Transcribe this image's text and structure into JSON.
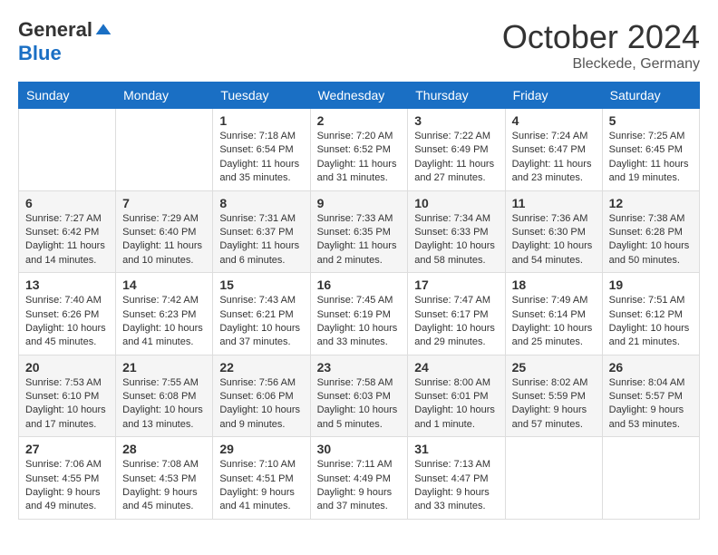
{
  "logo": {
    "general": "General",
    "blue": "Blue"
  },
  "title": "October 2024",
  "subtitle": "Bleckede, Germany",
  "days_of_week": [
    "Sunday",
    "Monday",
    "Tuesday",
    "Wednesday",
    "Thursday",
    "Friday",
    "Saturday"
  ],
  "weeks": [
    [
      {
        "day": "",
        "sunrise": "",
        "sunset": "",
        "daylight": ""
      },
      {
        "day": "",
        "sunrise": "",
        "sunset": "",
        "daylight": ""
      },
      {
        "day": "1",
        "sunrise": "Sunrise: 7:18 AM",
        "sunset": "Sunset: 6:54 PM",
        "daylight": "Daylight: 11 hours and 35 minutes."
      },
      {
        "day": "2",
        "sunrise": "Sunrise: 7:20 AM",
        "sunset": "Sunset: 6:52 PM",
        "daylight": "Daylight: 11 hours and 31 minutes."
      },
      {
        "day": "3",
        "sunrise": "Sunrise: 7:22 AM",
        "sunset": "Sunset: 6:49 PM",
        "daylight": "Daylight: 11 hours and 27 minutes."
      },
      {
        "day": "4",
        "sunrise": "Sunrise: 7:24 AM",
        "sunset": "Sunset: 6:47 PM",
        "daylight": "Daylight: 11 hours and 23 minutes."
      },
      {
        "day": "5",
        "sunrise": "Sunrise: 7:25 AM",
        "sunset": "Sunset: 6:45 PM",
        "daylight": "Daylight: 11 hours and 19 minutes."
      }
    ],
    [
      {
        "day": "6",
        "sunrise": "Sunrise: 7:27 AM",
        "sunset": "Sunset: 6:42 PM",
        "daylight": "Daylight: 11 hours and 14 minutes."
      },
      {
        "day": "7",
        "sunrise": "Sunrise: 7:29 AM",
        "sunset": "Sunset: 6:40 PM",
        "daylight": "Daylight: 11 hours and 10 minutes."
      },
      {
        "day": "8",
        "sunrise": "Sunrise: 7:31 AM",
        "sunset": "Sunset: 6:37 PM",
        "daylight": "Daylight: 11 hours and 6 minutes."
      },
      {
        "day": "9",
        "sunrise": "Sunrise: 7:33 AM",
        "sunset": "Sunset: 6:35 PM",
        "daylight": "Daylight: 11 hours and 2 minutes."
      },
      {
        "day": "10",
        "sunrise": "Sunrise: 7:34 AM",
        "sunset": "Sunset: 6:33 PM",
        "daylight": "Daylight: 10 hours and 58 minutes."
      },
      {
        "day": "11",
        "sunrise": "Sunrise: 7:36 AM",
        "sunset": "Sunset: 6:30 PM",
        "daylight": "Daylight: 10 hours and 54 minutes."
      },
      {
        "day": "12",
        "sunrise": "Sunrise: 7:38 AM",
        "sunset": "Sunset: 6:28 PM",
        "daylight": "Daylight: 10 hours and 50 minutes."
      }
    ],
    [
      {
        "day": "13",
        "sunrise": "Sunrise: 7:40 AM",
        "sunset": "Sunset: 6:26 PM",
        "daylight": "Daylight: 10 hours and 45 minutes."
      },
      {
        "day": "14",
        "sunrise": "Sunrise: 7:42 AM",
        "sunset": "Sunset: 6:23 PM",
        "daylight": "Daylight: 10 hours and 41 minutes."
      },
      {
        "day": "15",
        "sunrise": "Sunrise: 7:43 AM",
        "sunset": "Sunset: 6:21 PM",
        "daylight": "Daylight: 10 hours and 37 minutes."
      },
      {
        "day": "16",
        "sunrise": "Sunrise: 7:45 AM",
        "sunset": "Sunset: 6:19 PM",
        "daylight": "Daylight: 10 hours and 33 minutes."
      },
      {
        "day": "17",
        "sunrise": "Sunrise: 7:47 AM",
        "sunset": "Sunset: 6:17 PM",
        "daylight": "Daylight: 10 hours and 29 minutes."
      },
      {
        "day": "18",
        "sunrise": "Sunrise: 7:49 AM",
        "sunset": "Sunset: 6:14 PM",
        "daylight": "Daylight: 10 hours and 25 minutes."
      },
      {
        "day": "19",
        "sunrise": "Sunrise: 7:51 AM",
        "sunset": "Sunset: 6:12 PM",
        "daylight": "Daylight: 10 hours and 21 minutes."
      }
    ],
    [
      {
        "day": "20",
        "sunrise": "Sunrise: 7:53 AM",
        "sunset": "Sunset: 6:10 PM",
        "daylight": "Daylight: 10 hours and 17 minutes."
      },
      {
        "day": "21",
        "sunrise": "Sunrise: 7:55 AM",
        "sunset": "Sunset: 6:08 PM",
        "daylight": "Daylight: 10 hours and 13 minutes."
      },
      {
        "day": "22",
        "sunrise": "Sunrise: 7:56 AM",
        "sunset": "Sunset: 6:06 PM",
        "daylight": "Daylight: 10 hours and 9 minutes."
      },
      {
        "day": "23",
        "sunrise": "Sunrise: 7:58 AM",
        "sunset": "Sunset: 6:03 PM",
        "daylight": "Daylight: 10 hours and 5 minutes."
      },
      {
        "day": "24",
        "sunrise": "Sunrise: 8:00 AM",
        "sunset": "Sunset: 6:01 PM",
        "daylight": "Daylight: 10 hours and 1 minute."
      },
      {
        "day": "25",
        "sunrise": "Sunrise: 8:02 AM",
        "sunset": "Sunset: 5:59 PM",
        "daylight": "Daylight: 9 hours and 57 minutes."
      },
      {
        "day": "26",
        "sunrise": "Sunrise: 8:04 AM",
        "sunset": "Sunset: 5:57 PM",
        "daylight": "Daylight: 9 hours and 53 minutes."
      }
    ],
    [
      {
        "day": "27",
        "sunrise": "Sunrise: 7:06 AM",
        "sunset": "Sunset: 4:55 PM",
        "daylight": "Daylight: 9 hours and 49 minutes."
      },
      {
        "day": "28",
        "sunrise": "Sunrise: 7:08 AM",
        "sunset": "Sunset: 4:53 PM",
        "daylight": "Daylight: 9 hours and 45 minutes."
      },
      {
        "day": "29",
        "sunrise": "Sunrise: 7:10 AM",
        "sunset": "Sunset: 4:51 PM",
        "daylight": "Daylight: 9 hours and 41 minutes."
      },
      {
        "day": "30",
        "sunrise": "Sunrise: 7:11 AM",
        "sunset": "Sunset: 4:49 PM",
        "daylight": "Daylight: 9 hours and 37 minutes."
      },
      {
        "day": "31",
        "sunrise": "Sunrise: 7:13 AM",
        "sunset": "Sunset: 4:47 PM",
        "daylight": "Daylight: 9 hours and 33 minutes."
      },
      {
        "day": "",
        "sunrise": "",
        "sunset": "",
        "daylight": ""
      },
      {
        "day": "",
        "sunrise": "",
        "sunset": "",
        "daylight": ""
      }
    ]
  ]
}
